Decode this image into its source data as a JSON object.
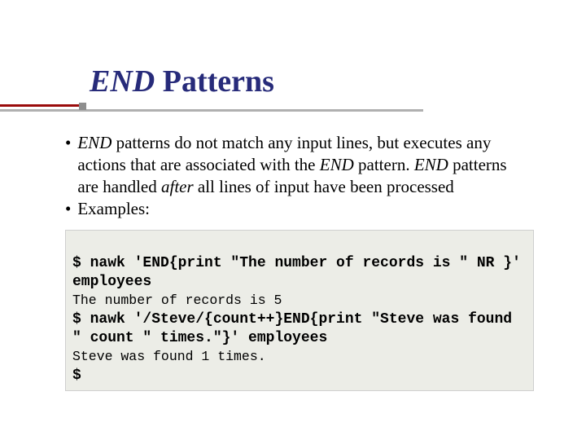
{
  "title": {
    "end": "END",
    "rest": " Patterns"
  },
  "body": {
    "p1_end": "END",
    "p1_rest": " patterns do not match any input lines, but executes any actions that are associated with the ",
    "p1_end2": "END",
    "p1_rest2": " pattern. ",
    "p1_end3": "END",
    "p1_rest3": " patterns are handled ",
    "p1_after": "after",
    "p1_rest4": " all lines of input have been processed",
    "p2": "Examples:"
  },
  "code": {
    "l1": "$ nawk 'END{print \"The number of records is \" NR }' employees",
    "l2": "The number of records is 5",
    "l3": "$ nawk '/Steve/{count++}END{print \"Steve was found \" count \" times.\"}' employees",
    "l4": "Steve was found 1 times.",
    "l5": "$"
  }
}
